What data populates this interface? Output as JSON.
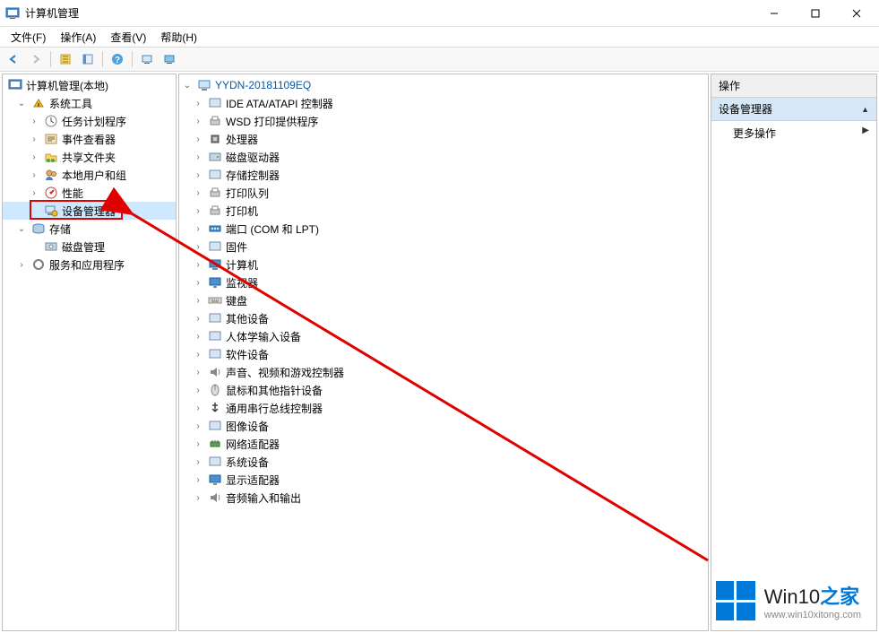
{
  "window": {
    "title": "计算机管理"
  },
  "menu": {
    "file": "文件(F)",
    "action": "操作(A)",
    "view": "查看(V)",
    "help": "帮助(H)"
  },
  "left_tree": {
    "root": "计算机管理(本地)",
    "system_tools": "系统工具",
    "task_scheduler": "任务计划程序",
    "event_viewer": "事件查看器",
    "shared_folders": "共享文件夹",
    "local_users": "本地用户和组",
    "performance": "性能",
    "device_manager": "设备管理器",
    "storage": "存储",
    "disk_mgmt": "磁盘管理",
    "services_apps": "服务和应用程序"
  },
  "mid_tree": {
    "root": "YYDN-20181109EQ",
    "items": [
      "IDE ATA/ATAPI 控制器",
      "WSD 打印提供程序",
      "处理器",
      "磁盘驱动器",
      "存储控制器",
      "打印队列",
      "打印机",
      "端口 (COM 和 LPT)",
      "固件",
      "计算机",
      "监视器",
      "键盘",
      "其他设备",
      "人体学输入设备",
      "软件设备",
      "声音、视频和游戏控制器",
      "鼠标和其他指针设备",
      "通用串行总线控制器",
      "图像设备",
      "网络适配器",
      "系统设备",
      "显示适配器",
      "音频输入和输出"
    ]
  },
  "right": {
    "header": "操作",
    "section": "设备管理器",
    "more": "更多操作"
  },
  "watermark": {
    "title_a": "Win10",
    "title_b": "之家",
    "url": "www.win10xitong.com"
  },
  "device_icons": [
    "ide-controller-icon",
    "wsd-print-icon",
    "cpu-icon",
    "disk-drive-icon",
    "storage-controller-icon",
    "print-queue-icon",
    "printer-icon",
    "port-icon",
    "firmware-icon",
    "computer-icon",
    "monitor-icon",
    "keyboard-icon",
    "other-device-icon",
    "hid-icon",
    "software-device-icon",
    "audio-video-icon",
    "mouse-icon",
    "usb-controller-icon",
    "image-device-icon",
    "network-adapter-icon",
    "system-device-icon",
    "display-adapter-icon",
    "audio-io-icon"
  ]
}
